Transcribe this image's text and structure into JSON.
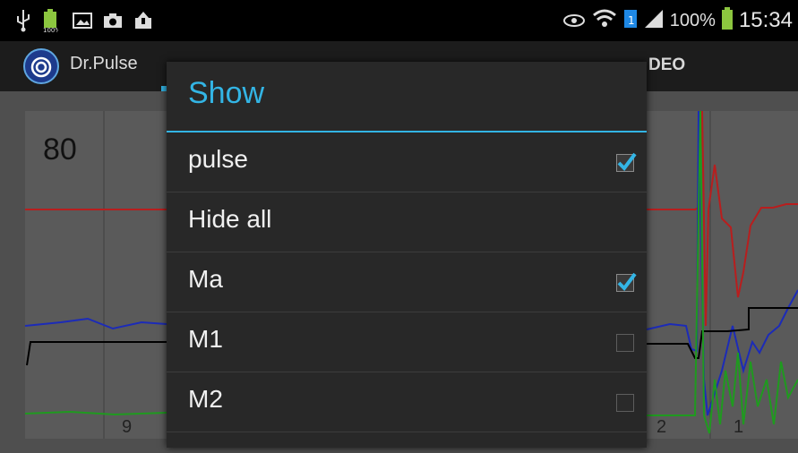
{
  "status_bar": {
    "battery_percent": "100%",
    "time": "15:34",
    "icons": [
      "usb-icon",
      "battery-charging-icon",
      "image-icon",
      "camera-icon",
      "upload-icon",
      "eye-icon",
      "wifi-icon",
      "sim-icon",
      "signal-icon",
      "battery-icon"
    ]
  },
  "app_bar": {
    "title": "Dr.Pulse",
    "tab_visible": "DEO"
  },
  "chart": {
    "value_label": "80",
    "bottom_ticks": [
      "9",
      "2",
      "1"
    ]
  },
  "dialog": {
    "title": "Show",
    "items": [
      {
        "label": "pulse",
        "checked": true,
        "has_checkbox": true
      },
      {
        "label": "Hide all",
        "checked": false,
        "has_checkbox": false
      },
      {
        "label": "Ma",
        "checked": true,
        "has_checkbox": true
      },
      {
        "label": "M1",
        "checked": false,
        "has_checkbox": true
      },
      {
        "label": "M2",
        "checked": false,
        "has_checkbox": true
      }
    ]
  },
  "colors": {
    "accent": "#33b5e5",
    "dialog_bg": "#282828",
    "series_red": "#b81e1e",
    "series_blue": "#1c2bb8",
    "series_green": "#1f9a1f",
    "series_black": "#000000"
  }
}
